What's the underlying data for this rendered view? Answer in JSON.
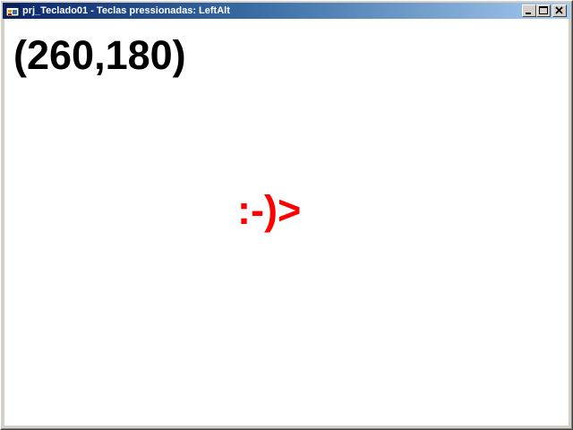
{
  "window": {
    "title": "prj_Teclado01 - Teclas pressionadas: LeftAlt",
    "icon": "application-icon",
    "buttons": {
      "minimize": "minimize-icon",
      "maximize": "maximize-icon",
      "close": "close-icon"
    }
  },
  "client": {
    "coordinates_text": "(260,180)",
    "smiley_text": ":-)>"
  },
  "colors": {
    "coordinates": "#000000",
    "smiley": "#ff0000",
    "titlebar_start": "#0a246a",
    "titlebar_end": "#a6caf0"
  }
}
